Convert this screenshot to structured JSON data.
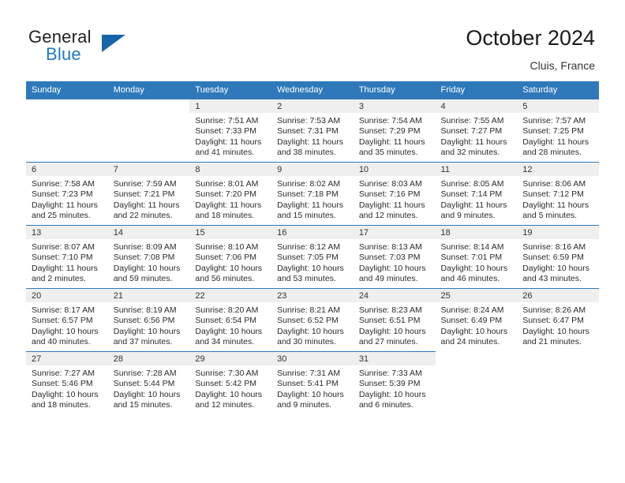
{
  "brand": {
    "name_top": "General",
    "name_bottom": "Blue",
    "triangle_color": "#1565a8",
    "blue": "#1f7ac4"
  },
  "header": {
    "title": "October 2024",
    "subtitle": "Cluis, France"
  },
  "theme": {
    "header_blue": "#2f79ba",
    "band_gray": "#f0f0f0",
    "text": "#2b2b2b"
  },
  "weekday_headers": [
    "Sunday",
    "Monday",
    "Tuesday",
    "Wednesday",
    "Thursday",
    "Friday",
    "Saturday"
  ],
  "labels": {
    "sunrise_prefix": "Sunrise:",
    "sunset_prefix": "Sunset:",
    "daylight_prefix": "Daylight:"
  },
  "weeks": [
    [
      {
        "day": "",
        "line1": "",
        "line2": "",
        "line3": "",
        "line4": ""
      },
      {
        "day": "",
        "line1": "",
        "line2": "",
        "line3": "",
        "line4": ""
      },
      {
        "day": "1",
        "line1": "Sunrise: 7:51 AM",
        "line2": "Sunset: 7:33 PM",
        "line3": "Daylight: 11 hours",
        "line4": "and 41 minutes."
      },
      {
        "day": "2",
        "line1": "Sunrise: 7:53 AM",
        "line2": "Sunset: 7:31 PM",
        "line3": "Daylight: 11 hours",
        "line4": "and 38 minutes."
      },
      {
        "day": "3",
        "line1": "Sunrise: 7:54 AM",
        "line2": "Sunset: 7:29 PM",
        "line3": "Daylight: 11 hours",
        "line4": "and 35 minutes."
      },
      {
        "day": "4",
        "line1": "Sunrise: 7:55 AM",
        "line2": "Sunset: 7:27 PM",
        "line3": "Daylight: 11 hours",
        "line4": "and 32 minutes."
      },
      {
        "day": "5",
        "line1": "Sunrise: 7:57 AM",
        "line2": "Sunset: 7:25 PM",
        "line3": "Daylight: 11 hours",
        "line4": "and 28 minutes."
      }
    ],
    [
      {
        "day": "6",
        "line1": "Sunrise: 7:58 AM",
        "line2": "Sunset: 7:23 PM",
        "line3": "Daylight: 11 hours",
        "line4": "and 25 minutes."
      },
      {
        "day": "7",
        "line1": "Sunrise: 7:59 AM",
        "line2": "Sunset: 7:21 PM",
        "line3": "Daylight: 11 hours",
        "line4": "and 22 minutes."
      },
      {
        "day": "8",
        "line1": "Sunrise: 8:01 AM",
        "line2": "Sunset: 7:20 PM",
        "line3": "Daylight: 11 hours",
        "line4": "and 18 minutes."
      },
      {
        "day": "9",
        "line1": "Sunrise: 8:02 AM",
        "line2": "Sunset: 7:18 PM",
        "line3": "Daylight: 11 hours",
        "line4": "and 15 minutes."
      },
      {
        "day": "10",
        "line1": "Sunrise: 8:03 AM",
        "line2": "Sunset: 7:16 PM",
        "line3": "Daylight: 11 hours",
        "line4": "and 12 minutes."
      },
      {
        "day": "11",
        "line1": "Sunrise: 8:05 AM",
        "line2": "Sunset: 7:14 PM",
        "line3": "Daylight: 11 hours",
        "line4": "and 9 minutes."
      },
      {
        "day": "12",
        "line1": "Sunrise: 8:06 AM",
        "line2": "Sunset: 7:12 PM",
        "line3": "Daylight: 11 hours",
        "line4": "and 5 minutes."
      }
    ],
    [
      {
        "day": "13",
        "line1": "Sunrise: 8:07 AM",
        "line2": "Sunset: 7:10 PM",
        "line3": "Daylight: 11 hours",
        "line4": "and 2 minutes."
      },
      {
        "day": "14",
        "line1": "Sunrise: 8:09 AM",
        "line2": "Sunset: 7:08 PM",
        "line3": "Daylight: 10 hours",
        "line4": "and 59 minutes."
      },
      {
        "day": "15",
        "line1": "Sunrise: 8:10 AM",
        "line2": "Sunset: 7:06 PM",
        "line3": "Daylight: 10 hours",
        "line4": "and 56 minutes."
      },
      {
        "day": "16",
        "line1": "Sunrise: 8:12 AM",
        "line2": "Sunset: 7:05 PM",
        "line3": "Daylight: 10 hours",
        "line4": "and 53 minutes."
      },
      {
        "day": "17",
        "line1": "Sunrise: 8:13 AM",
        "line2": "Sunset: 7:03 PM",
        "line3": "Daylight: 10 hours",
        "line4": "and 49 minutes."
      },
      {
        "day": "18",
        "line1": "Sunrise: 8:14 AM",
        "line2": "Sunset: 7:01 PM",
        "line3": "Daylight: 10 hours",
        "line4": "and 46 minutes."
      },
      {
        "day": "19",
        "line1": "Sunrise: 8:16 AM",
        "line2": "Sunset: 6:59 PM",
        "line3": "Daylight: 10 hours",
        "line4": "and 43 minutes."
      }
    ],
    [
      {
        "day": "20",
        "line1": "Sunrise: 8:17 AM",
        "line2": "Sunset: 6:57 PM",
        "line3": "Daylight: 10 hours",
        "line4": "and 40 minutes."
      },
      {
        "day": "21",
        "line1": "Sunrise: 8:19 AM",
        "line2": "Sunset: 6:56 PM",
        "line3": "Daylight: 10 hours",
        "line4": "and 37 minutes."
      },
      {
        "day": "22",
        "line1": "Sunrise: 8:20 AM",
        "line2": "Sunset: 6:54 PM",
        "line3": "Daylight: 10 hours",
        "line4": "and 34 minutes."
      },
      {
        "day": "23",
        "line1": "Sunrise: 8:21 AM",
        "line2": "Sunset: 6:52 PM",
        "line3": "Daylight: 10 hours",
        "line4": "and 30 minutes."
      },
      {
        "day": "24",
        "line1": "Sunrise: 8:23 AM",
        "line2": "Sunset: 6:51 PM",
        "line3": "Daylight: 10 hours",
        "line4": "and 27 minutes."
      },
      {
        "day": "25",
        "line1": "Sunrise: 8:24 AM",
        "line2": "Sunset: 6:49 PM",
        "line3": "Daylight: 10 hours",
        "line4": "and 24 minutes."
      },
      {
        "day": "26",
        "line1": "Sunrise: 8:26 AM",
        "line2": "Sunset: 6:47 PM",
        "line3": "Daylight: 10 hours",
        "line4": "and 21 minutes."
      }
    ],
    [
      {
        "day": "27",
        "line1": "Sunrise: 7:27 AM",
        "line2": "Sunset: 5:46 PM",
        "line3": "Daylight: 10 hours",
        "line4": "and 18 minutes."
      },
      {
        "day": "28",
        "line1": "Sunrise: 7:28 AM",
        "line2": "Sunset: 5:44 PM",
        "line3": "Daylight: 10 hours",
        "line4": "and 15 minutes."
      },
      {
        "day": "29",
        "line1": "Sunrise: 7:30 AM",
        "line2": "Sunset: 5:42 PM",
        "line3": "Daylight: 10 hours",
        "line4": "and 12 minutes."
      },
      {
        "day": "30",
        "line1": "Sunrise: 7:31 AM",
        "line2": "Sunset: 5:41 PM",
        "line3": "Daylight: 10 hours",
        "line4": "and 9 minutes."
      },
      {
        "day": "31",
        "line1": "Sunrise: 7:33 AM",
        "line2": "Sunset: 5:39 PM",
        "line3": "Daylight: 10 hours",
        "line4": "and 6 minutes."
      },
      {
        "day": "",
        "line1": "",
        "line2": "",
        "line3": "",
        "line4": ""
      },
      {
        "day": "",
        "line1": "",
        "line2": "",
        "line3": "",
        "line4": ""
      }
    ]
  ]
}
